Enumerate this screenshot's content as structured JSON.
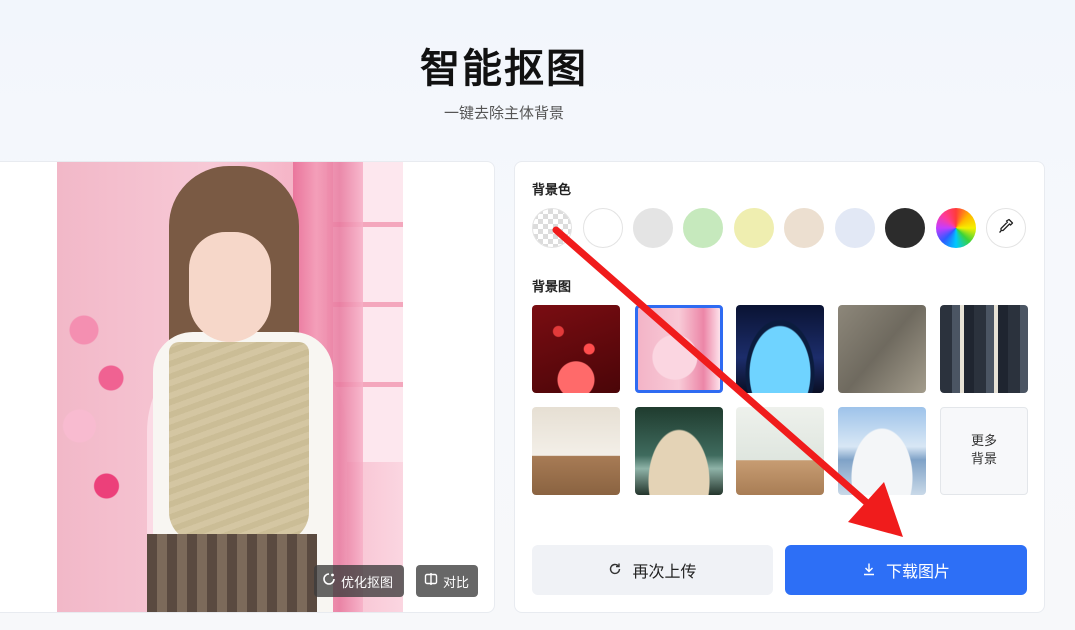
{
  "header": {
    "title": "智能抠图",
    "subtitle": "一键去除主体背景"
  },
  "preview": {
    "optimize_label": "优化抠图",
    "compare_label": "对比"
  },
  "panel": {
    "bg_color_label": "背景色",
    "bg_image_label": "背景图",
    "colors": [
      {
        "name": "transparent",
        "value": "transparent"
      },
      {
        "name": "white",
        "value": "#ffffff"
      },
      {
        "name": "gray",
        "value": "#e4e4e4"
      },
      {
        "name": "green",
        "value": "#c6e9bd"
      },
      {
        "name": "yellow",
        "value": "#efeeb0"
      },
      {
        "name": "beige",
        "value": "#ecdfd0"
      },
      {
        "name": "light-blue",
        "value": "#e2e8f5"
      },
      {
        "name": "black",
        "value": "#2c2c2c"
      },
      {
        "name": "rainbow",
        "value": "custom"
      },
      {
        "name": "eyedropper-icon",
        "value": "picker"
      }
    ],
    "more_line1": "更多",
    "more_line2": "背景",
    "reupload_label": "再次上传",
    "download_label": "下载图片"
  },
  "accent_color": "#2d6ff6",
  "arrow_color": "#f01c1c"
}
